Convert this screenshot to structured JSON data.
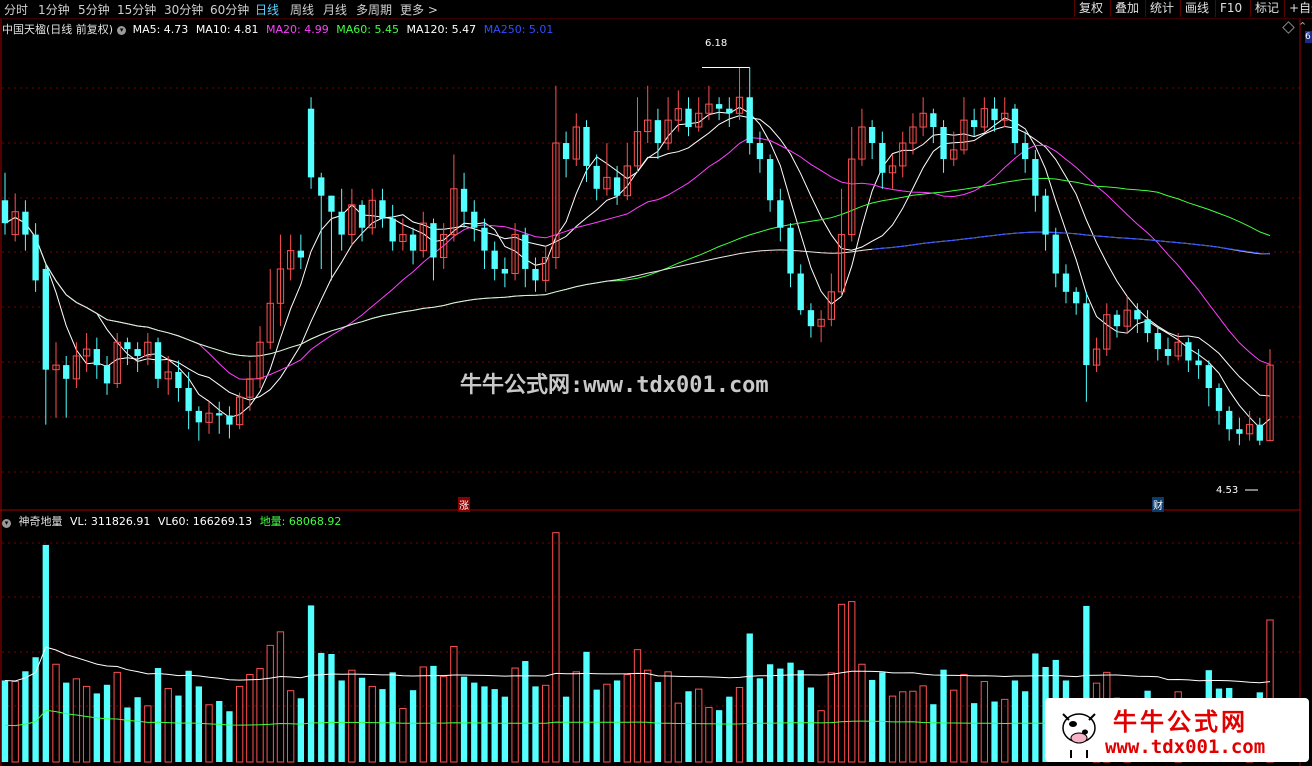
{
  "toolbar": {
    "periods": [
      "分时",
      "1分钟",
      "5分钟",
      "15分钟",
      "30分钟",
      "60分钟",
      "日线",
      "周线",
      "月线",
      "多周期",
      "更多 >"
    ],
    "active_period": "日线",
    "buttons": [
      "复权",
      "叠加",
      "统计",
      "画线",
      "F10",
      "标记",
      "+自选"
    ]
  },
  "main_legend": {
    "title": "中国天楹(日线 前复权)",
    "items": [
      {
        "label": "MA5: 4.73",
        "color": "#ffffff"
      },
      {
        "label": "MA10: 4.81",
        "color": "#ffffff"
      },
      {
        "label": "MA20: 4.99",
        "color": "#ff40ff"
      },
      {
        "label": "MA60: 5.45",
        "color": "#40ff40"
      },
      {
        "label": "MA120: 5.47",
        "color": "#ffffff"
      },
      {
        "label": "MA250: 5.01",
        "color": "#3050ff"
      }
    ]
  },
  "volume_legend": {
    "title": "神奇地量",
    "items": [
      {
        "label": "VL: 311826.91",
        "color": "#ffffff"
      },
      {
        "label": "VL60: 166269.13",
        "color": "#ffffff"
      },
      {
        "label": "地量: 68068.92",
        "color": "#40ff40"
      }
    ]
  },
  "markers": {
    "high_label": "6.18",
    "low_label": "4.53",
    "zhang": "涨",
    "cai": "财",
    "right_tag": "6"
  },
  "watermark": "牛牛公式网:www.tdx001.com",
  "logo": {
    "title": "牛牛公式网",
    "url": "www.tdx001.com"
  },
  "colors": {
    "up": "#ff5050",
    "down": "#54ffff",
    "ma20": "#ff40ff",
    "ma60": "#40ff40",
    "ma250": "#3050ff",
    "grid": "#7a0000"
  },
  "chart_data": {
    "type": "candlestick",
    "y_range": [
      4.4,
      6.3
    ],
    "high": 6.18,
    "low": 4.53,
    "candles": [
      [
        5.6,
        5.5,
        5.72,
        5.45
      ],
      [
        5.45,
        5.55,
        5.63,
        5.42
      ],
      [
        5.55,
        5.45,
        5.6,
        5.38
      ],
      [
        5.45,
        5.25,
        5.5,
        5.2
      ],
      [
        5.3,
        4.86,
        5.32,
        4.62
      ],
      [
        4.86,
        4.88,
        4.98,
        4.65
      ],
      [
        4.88,
        4.82,
        4.92,
        4.65
      ],
      [
        4.82,
        4.92,
        4.98,
        4.78
      ],
      [
        4.92,
        4.95,
        5.02,
        4.85
      ],
      [
        4.95,
        4.88,
        5.0,
        4.82
      ],
      [
        4.88,
        4.8,
        4.92,
        4.75
      ],
      [
        4.8,
        4.98,
        5.02,
        4.78
      ],
      [
        4.98,
        4.95,
        5.0,
        4.88
      ],
      [
        4.95,
        4.92,
        4.98,
        4.85
      ],
      [
        4.92,
        4.98,
        5.02,
        4.88
      ],
      [
        4.98,
        4.82,
        5.0,
        4.78
      ],
      [
        4.82,
        4.85,
        4.92,
        4.75
      ],
      [
        4.85,
        4.78,
        4.9,
        4.72
      ],
      [
        4.78,
        4.68,
        4.85,
        4.6
      ],
      [
        4.68,
        4.63,
        4.7,
        4.55
      ],
      [
        4.63,
        4.67,
        4.72,
        4.58
      ],
      [
        4.67,
        4.66,
        4.72,
        4.58
      ],
      [
        4.66,
        4.62,
        4.7,
        4.56
      ],
      [
        4.62,
        4.74,
        4.76,
        4.6
      ],
      [
        4.74,
        4.82,
        4.9,
        4.68
      ],
      [
        4.82,
        4.98,
        5.05,
        4.78
      ],
      [
        4.98,
        5.15,
        5.3,
        4.95
      ],
      [
        5.15,
        5.3,
        5.45,
        5.05
      ],
      [
        5.3,
        5.38,
        5.45,
        5.25
      ],
      [
        5.38,
        5.35,
        5.45,
        5.3
      ],
      [
        6.0,
        5.7,
        6.05,
        5.65
      ],
      [
        5.7,
        5.62,
        5.72,
        5.3
      ],
      [
        5.62,
        5.55,
        5.62,
        5.25
      ],
      [
        5.55,
        5.45,
        5.65,
        5.38
      ],
      [
        5.45,
        5.58,
        5.65,
        5.4
      ],
      [
        5.58,
        5.48,
        5.6,
        5.42
      ],
      [
        5.48,
        5.6,
        5.65,
        5.45
      ],
      [
        5.6,
        5.52,
        5.65,
        5.48
      ],
      [
        5.52,
        5.42,
        5.58,
        5.38
      ],
      [
        5.42,
        5.45,
        5.52,
        5.38
      ],
      [
        5.45,
        5.38,
        5.48,
        5.32
      ],
      [
        5.38,
        5.5,
        5.55,
        5.35
      ],
      [
        5.5,
        5.35,
        5.52,
        5.25
      ],
      [
        5.35,
        5.45,
        5.5,
        5.3
      ],
      [
        5.45,
        5.65,
        5.8,
        5.42
      ],
      [
        5.65,
        5.55,
        5.72,
        5.48
      ],
      [
        5.55,
        5.48,
        5.6,
        5.42
      ],
      [
        5.48,
        5.38,
        5.52,
        5.3
      ],
      [
        5.38,
        5.3,
        5.42,
        5.25
      ],
      [
        5.3,
        5.28,
        5.35,
        5.22
      ],
      [
        5.28,
        5.45,
        5.5,
        5.25
      ],
      [
        5.45,
        5.3,
        5.48,
        5.22
      ],
      [
        5.3,
        5.25,
        5.35,
        5.2
      ],
      [
        5.25,
        5.35,
        5.4,
        5.2
      ],
      [
        5.35,
        5.85,
        6.1,
        5.3
      ],
      [
        5.85,
        5.78,
        5.9,
        5.7
      ],
      [
        5.78,
        5.92,
        5.98,
        5.75
      ],
      [
        5.92,
        5.75,
        5.95,
        5.68
      ],
      [
        5.75,
        5.65,
        5.8,
        5.6
      ],
      [
        5.65,
        5.7,
        5.85,
        5.62
      ],
      [
        5.7,
        5.62,
        5.75,
        5.58
      ],
      [
        5.62,
        5.75,
        5.85,
        5.6
      ],
      [
        5.75,
        5.9,
        6.05,
        5.72
      ],
      [
        5.9,
        5.95,
        6.1,
        5.85
      ],
      [
        5.95,
        5.85,
        6.0,
        5.78
      ],
      [
        5.85,
        5.95,
        6.05,
        5.82
      ],
      [
        5.95,
        6.0,
        6.08,
        5.9
      ],
      [
        6.0,
        5.92,
        6.05,
        5.88
      ],
      [
        5.92,
        5.98,
        6.05,
        5.9
      ],
      [
        5.98,
        6.02,
        6.1,
        5.95
      ],
      [
        6.02,
        6.0,
        6.05,
        5.95
      ],
      [
        6.0,
        5.98,
        6.05,
        5.92
      ],
      [
        5.98,
        6.05,
        6.18,
        5.95
      ],
      [
        6.05,
        5.85,
        6.18,
        5.8
      ],
      [
        5.85,
        5.78,
        5.9,
        5.72
      ],
      [
        5.78,
        5.6,
        5.8,
        5.55
      ],
      [
        5.6,
        5.48,
        5.65,
        5.42
      ],
      [
        5.48,
        5.28,
        5.5,
        5.22
      ],
      [
        5.28,
        5.12,
        5.32,
        5.1
      ],
      [
        5.12,
        5.05,
        5.15,
        5.0
      ],
      [
        5.05,
        5.08,
        5.12,
        4.98
      ],
      [
        5.08,
        5.2,
        5.28,
        5.05
      ],
      [
        5.2,
        5.45,
        5.65,
        5.18
      ],
      [
        5.45,
        5.78,
        5.92,
        5.42
      ],
      [
        5.78,
        5.92,
        6.0,
        5.75
      ],
      [
        5.92,
        5.85,
        5.95,
        5.78
      ],
      [
        5.85,
        5.72,
        5.9,
        5.65
      ],
      [
        5.72,
        5.75,
        5.8,
        5.65
      ],
      [
        5.75,
        5.85,
        5.9,
        5.7
      ],
      [
        5.85,
        5.92,
        5.98,
        5.8
      ],
      [
        5.92,
        5.98,
        6.05,
        5.88
      ],
      [
        5.98,
        5.92,
        6.0,
        5.85
      ],
      [
        5.92,
        5.78,
        5.95,
        5.72
      ],
      [
        5.78,
        5.82,
        5.9,
        5.75
      ],
      [
        5.82,
        5.95,
        6.05,
        5.8
      ],
      [
        5.95,
        5.92,
        6.0,
        5.88
      ],
      [
        5.92,
        6.0,
        6.05,
        5.9
      ],
      [
        6.0,
        5.95,
        6.05,
        5.9
      ],
      [
        5.95,
        5.98,
        6.05,
        5.92
      ],
      [
        6.0,
        5.85,
        6.02,
        5.8
      ],
      [
        5.85,
        5.78,
        5.9,
        5.72
      ],
      [
        5.78,
        5.62,
        5.82,
        5.55
      ],
      [
        5.62,
        5.45,
        5.65,
        5.38
      ],
      [
        5.45,
        5.28,
        5.48,
        5.22
      ],
      [
        5.28,
        5.2,
        5.32,
        5.15
      ],
      [
        5.2,
        5.15,
        5.22,
        5.1
      ],
      [
        5.15,
        4.88,
        5.2,
        4.72
      ],
      [
        4.88,
        4.95,
        5.0,
        4.85
      ],
      [
        4.95,
        5.1,
        5.15,
        4.92
      ],
      [
        5.1,
        5.05,
        5.12,
        5.0
      ],
      [
        5.05,
        5.12,
        5.18,
        5.02
      ],
      [
        5.12,
        5.08,
        5.15,
        5.02
      ],
      [
        5.08,
        5.02,
        5.12,
        4.98
      ],
      [
        5.02,
        4.95,
        5.05,
        4.9
      ],
      [
        4.95,
        4.92,
        5.0,
        4.88
      ],
      [
        4.92,
        4.98,
        5.02,
        4.9
      ],
      [
        4.98,
        4.9,
        5.0,
        4.85
      ],
      [
        4.9,
        4.88,
        4.95,
        4.82
      ],
      [
        4.88,
        4.78,
        4.9,
        4.7
      ],
      [
        4.78,
        4.68,
        4.8,
        4.62
      ],
      [
        4.68,
        4.6,
        4.7,
        4.55
      ],
      [
        4.6,
        4.58,
        4.65,
        4.53
      ],
      [
        4.58,
        4.62,
        4.68,
        4.55
      ],
      [
        4.62,
        4.55,
        4.65,
        4.53
      ],
      [
        4.55,
        4.88,
        4.95,
        4.55
      ]
    ],
    "volume_range": [
      0,
      1300000
    ]
  }
}
